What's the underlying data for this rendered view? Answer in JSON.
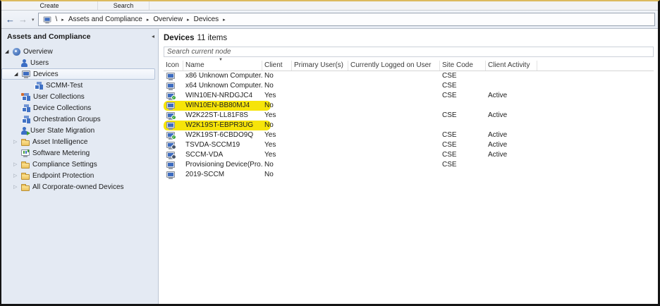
{
  "tabs": [
    "Create",
    "Search"
  ],
  "nav": {
    "root": "\\",
    "crumbs": [
      "Assets and Compliance",
      "Overview",
      "Devices"
    ]
  },
  "icons": {
    "expanded": "◢",
    "collapsed": "▷",
    "separator": "▸",
    "sort_desc": "▼",
    "collapse_panel": "◂",
    "back": "←",
    "forward": "→",
    "caret": "▾",
    "check": "✓"
  },
  "colors": {
    "highlight": "#f6e409",
    "accent_blue": "#3d6cc0",
    "sidebar_bg": "#e4eaf3"
  },
  "sidebar": {
    "title": "Assets and Compliance",
    "items": [
      {
        "label": "Overview",
        "icon": "overview",
        "level": 1,
        "expander": "expanded",
        "selected": false
      },
      {
        "label": "Users",
        "icon": "user",
        "level": 2,
        "expander": null,
        "selected": false
      },
      {
        "label": "Devices",
        "icon": "monitor",
        "level": 2,
        "expander": "expanded",
        "selected": true
      },
      {
        "label": "SCMM-Test",
        "icon": "collection",
        "level": 3,
        "expander": null,
        "selected": false
      },
      {
        "label": "User Collections",
        "icon": "user-collection",
        "level": 2,
        "expander": null,
        "selected": false
      },
      {
        "label": "Device Collections",
        "icon": "collection",
        "level": 2,
        "expander": null,
        "selected": false
      },
      {
        "label": "Orchestration Groups",
        "icon": "collection",
        "level": 2,
        "expander": null,
        "selected": false
      },
      {
        "label": "User State Migration",
        "icon": "user-migration",
        "level": 2,
        "expander": null,
        "selected": false
      },
      {
        "label": "Asset Intelligence",
        "icon": "folder",
        "level": 2,
        "expander": "collapsed",
        "selected": false
      },
      {
        "label": "Software Metering",
        "icon": "metering",
        "level": 2,
        "expander": null,
        "selected": false
      },
      {
        "label": "Compliance Settings",
        "icon": "folder",
        "level": 2,
        "expander": "collapsed",
        "selected": false
      },
      {
        "label": "Endpoint Protection",
        "icon": "folder",
        "level": 2,
        "expander": "collapsed",
        "selected": false
      },
      {
        "label": "All Corporate-owned Devices",
        "icon": "folder",
        "level": 2,
        "expander": "collapsed",
        "selected": false
      }
    ]
  },
  "main": {
    "title": "Devices",
    "count": "11 items",
    "search_placeholder": "Search current node",
    "table": {
      "columns": [
        "Icon",
        "Name",
        "Client",
        "Primary User(s)",
        "Currently Logged on User",
        "Site Code",
        "Client Activity"
      ],
      "sort_column": "Name",
      "sort_direction": "desc",
      "rows": [
        {
          "icon": "computer",
          "name": "x86 Unknown Computer...",
          "client": "No",
          "primary_users": "",
          "logged_on": "",
          "site_code": "CSE",
          "activity": "",
          "highlight": false
        },
        {
          "icon": "computer",
          "name": "x64 Unknown Computer...",
          "client": "No",
          "primary_users": "",
          "logged_on": "",
          "site_code": "CSE",
          "activity": "",
          "highlight": false
        },
        {
          "icon": "computer-check",
          "name": "WIN10EN-NRDGJC4",
          "client": "Yes",
          "primary_users": "",
          "logged_on": "",
          "site_code": "CSE",
          "activity": "Active",
          "highlight": false
        },
        {
          "icon": "computer",
          "name": "WIN10EN-BB80MJ4",
          "client": "No",
          "primary_users": "",
          "logged_on": "",
          "site_code": "",
          "activity": "",
          "highlight": true
        },
        {
          "icon": "computer-check",
          "name": "W2K22ST-LL81F8S",
          "client": "Yes",
          "primary_users": "",
          "logged_on": "",
          "site_code": "CSE",
          "activity": "Active",
          "highlight": false
        },
        {
          "icon": "computer",
          "name": "W2K19ST-EBPR3UG",
          "client": "No",
          "primary_users": "",
          "logged_on": "",
          "site_code": "",
          "activity": "",
          "highlight": true
        },
        {
          "icon": "computer-check",
          "name": "W2K19ST-6CBDO9Q",
          "client": "Yes",
          "primary_users": "",
          "logged_on": "",
          "site_code": "CSE",
          "activity": "Active",
          "highlight": false
        },
        {
          "icon": "computer-dark",
          "name": "TSVDA-SCCM19",
          "client": "Yes",
          "primary_users": "",
          "logged_on": "",
          "site_code": "CSE",
          "activity": "Active",
          "highlight": false
        },
        {
          "icon": "computer-dark",
          "name": "SCCM-VDA",
          "client": "Yes",
          "primary_users": "",
          "logged_on": "",
          "site_code": "CSE",
          "activity": "Active",
          "highlight": false
        },
        {
          "icon": "computer",
          "name": "Provisioning Device(Pro...",
          "client": "No",
          "primary_users": "",
          "logged_on": "",
          "site_code": "CSE",
          "activity": "",
          "highlight": false
        },
        {
          "icon": "computer",
          "name": "2019-SCCM",
          "client": "No",
          "primary_users": "",
          "logged_on": "",
          "site_code": "",
          "activity": "",
          "highlight": false
        }
      ]
    }
  }
}
